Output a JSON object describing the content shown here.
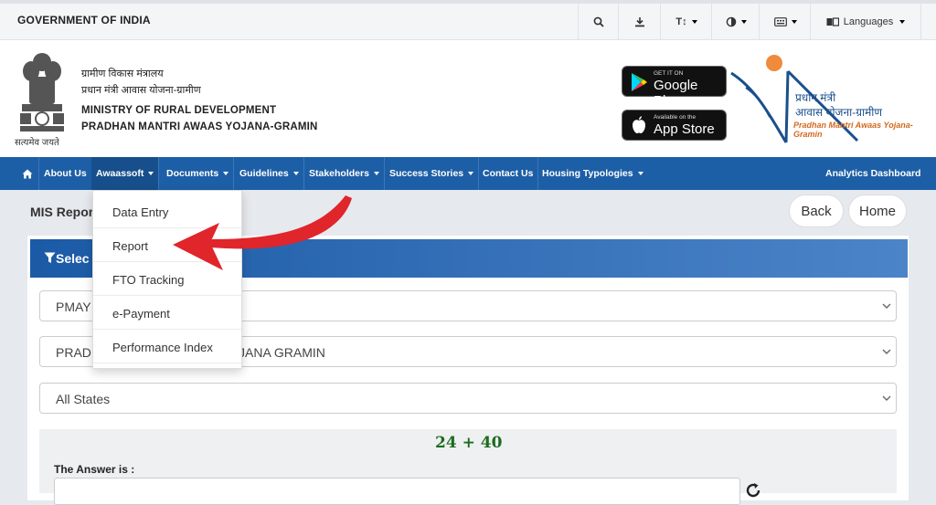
{
  "topbar": {
    "title": "GOVERNMENT OF INDIA",
    "search_icon": "search-icon",
    "download_icon": "download-icon",
    "text_size_label": "T↕",
    "contrast_icon": "contrast-icon",
    "sitemap_icon": "keyboard-icon",
    "languages_label": "Languages"
  },
  "header": {
    "hindi_line1": "ग्रामीण विकास मंत्रालय",
    "hindi_line2": "प्रधान मंत्री आवास योजना-ग्रामीण",
    "english_line1": "MINISTRY OF RURAL DEVELOPMENT",
    "english_line2": "PRADHAN MANTRI AWAAS YOJANA-GRAMIN",
    "emblem_caption": "सत्यमेव जयते",
    "google_play_small": "GET IT ON",
    "google_play_big": "Google Play",
    "app_store_small": "Available on the",
    "app_store_big": "App Store",
    "pm_logo_hindi1": "प्रधान मंत्री",
    "pm_logo_hindi2": "आवास योजना-ग्रामीण",
    "pm_logo_english": "Pradhan Mantri Awaas Yojana-Gramin"
  },
  "nav": {
    "home_icon": "home-icon",
    "items": [
      {
        "label": "About Us"
      },
      {
        "label": "Awaassoft"
      },
      {
        "label": "Documents"
      },
      {
        "label": "Guidelines"
      },
      {
        "label": "Stakeholders"
      },
      {
        "label": "Success Stories"
      },
      {
        "label": "Contact Us"
      },
      {
        "label": "Housing Typologies"
      }
    ],
    "right_label": "Analytics Dashboard"
  },
  "dropdown_menu": {
    "items": [
      {
        "label": "Data Entry"
      },
      {
        "label": "Report"
      },
      {
        "label": "FTO Tracking"
      },
      {
        "label": "e-Payment"
      },
      {
        "label": "Performance Index"
      }
    ]
  },
  "page": {
    "title": "MIS Repor",
    "back_label": "Back",
    "home_label": "Home",
    "select_label": "Selec",
    "filter_icon": "filter-icon"
  },
  "form": {
    "scheme_value": "PMAY",
    "scheme_program_left": "PRADI",
    "scheme_program_right": "JANA GRAMIN",
    "state_value": "All States",
    "captcha_text": "24 + 40",
    "answer_label": "The Answer is :",
    "refresh_icon": "refresh-icon"
  },
  "annotation": {
    "arrow_color": "#e0252b"
  }
}
